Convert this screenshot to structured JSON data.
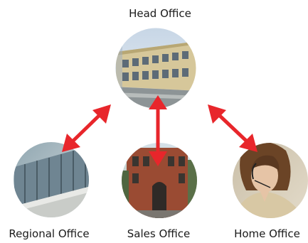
{
  "nodes": {
    "head": {
      "label": "Head Office",
      "photo": "office-building-photo"
    },
    "regional": {
      "label": "Regional Office",
      "photo": "glass-atrium-photo"
    },
    "sales": {
      "label": "Sales Office",
      "photo": "brick-building-photo"
    },
    "home": {
      "label": "Home Office",
      "photo": "woman-with-headset-photo"
    }
  },
  "connections": [
    {
      "from": "head",
      "to": "regional",
      "type": "bidirectional"
    },
    {
      "from": "head",
      "to": "sales",
      "type": "bidirectional"
    },
    {
      "from": "head",
      "to": "home",
      "type": "bidirectional"
    }
  ],
  "colors": {
    "arrow": "#e8262b",
    "background": "#ffffff",
    "label": "#1a1a1a"
  }
}
